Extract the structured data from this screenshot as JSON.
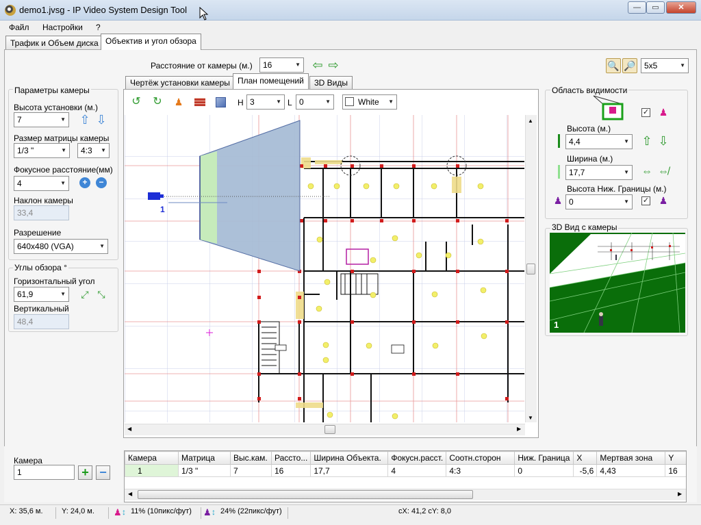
{
  "window": {
    "title": "demo1.jvsg - IP Video System Design Tool"
  },
  "menu": [
    "Файл",
    "Настройки",
    "?"
  ],
  "main_tabs": [
    "Трафик и Объем диска",
    "Объектив и угол обзора"
  ],
  "toolbar": {
    "distance_label": "Расстояние от камеры (м.)",
    "distance_value": "16",
    "grid_value": "5x5"
  },
  "view_tabs": [
    "Чертёж установки камеры",
    "План помещений",
    "3D Виды"
  ],
  "plan_toolbar": {
    "h_label": "H",
    "h_value": "3",
    "l_label": "L",
    "l_value": "0",
    "color_value": "White"
  },
  "camera_params": {
    "title": "Параметры камеры",
    "height_label": "Высота установки (м.)",
    "height_value": "7",
    "sensor_label": "Размер матрицы камеры",
    "sensor_value": "1/3 \"",
    "aspect_value": "4:3",
    "focal_label": "Фокусное расстояние(мм)",
    "focal_value": "4",
    "tilt_label": "Наклон камеры",
    "tilt_value": "33,4",
    "resolution_label": "Разрешение",
    "resolution_value": "640x480 (VGA)"
  },
  "view_angles": {
    "title": "Углы обзора °",
    "horizontal_label": "Горизонтальный угол",
    "horizontal_value": "61,9",
    "vertical_label": "Вертикальный",
    "vertical_value": "48,4"
  },
  "visibility": {
    "title": "Область видимости",
    "height_label": "Высота (м.)",
    "height_value": "4,4",
    "width_label": "Ширина (м.)",
    "width_value": "17,7",
    "lower_label": "Высота Ниж. Границы (м.)",
    "lower_value": "0"
  },
  "view3d": {
    "title": "3D Вид с камеры",
    "camera_number": "1"
  },
  "plan": {
    "camera_label": "1"
  },
  "camera_list": {
    "label": "Камера",
    "value": "1"
  },
  "table": {
    "columns": [
      "Камера",
      "Матрица",
      "Выс.кам.",
      "Рассто...",
      "Ширина Объекта.",
      "Фокусн.расст.",
      "Соотн.сторон",
      "Ниж. Граница",
      "X",
      "Мертвая зона",
      "Y"
    ],
    "rows": [
      [
        "1",
        "1/3 \"",
        "7",
        "16",
        "17,7",
        "4",
        "4:3",
        "0",
        "-5,6",
        "4,43",
        "16"
      ]
    ]
  },
  "status": {
    "x": "X: 35,6 м.",
    "y": "Y: 24,0 м.",
    "density1": "11% (10пикс/фут)",
    "density2": "24% (22пикс/фут)",
    "cxy": "cX: 41,2 cY: 8,0"
  },
  "colors": {
    "accent_green": "#1a8a1a",
    "fov_fill": "#a8bdd6",
    "magenta": "#d81b8c",
    "purple": "#7a1fa2",
    "ground": "#0a6e0a"
  }
}
